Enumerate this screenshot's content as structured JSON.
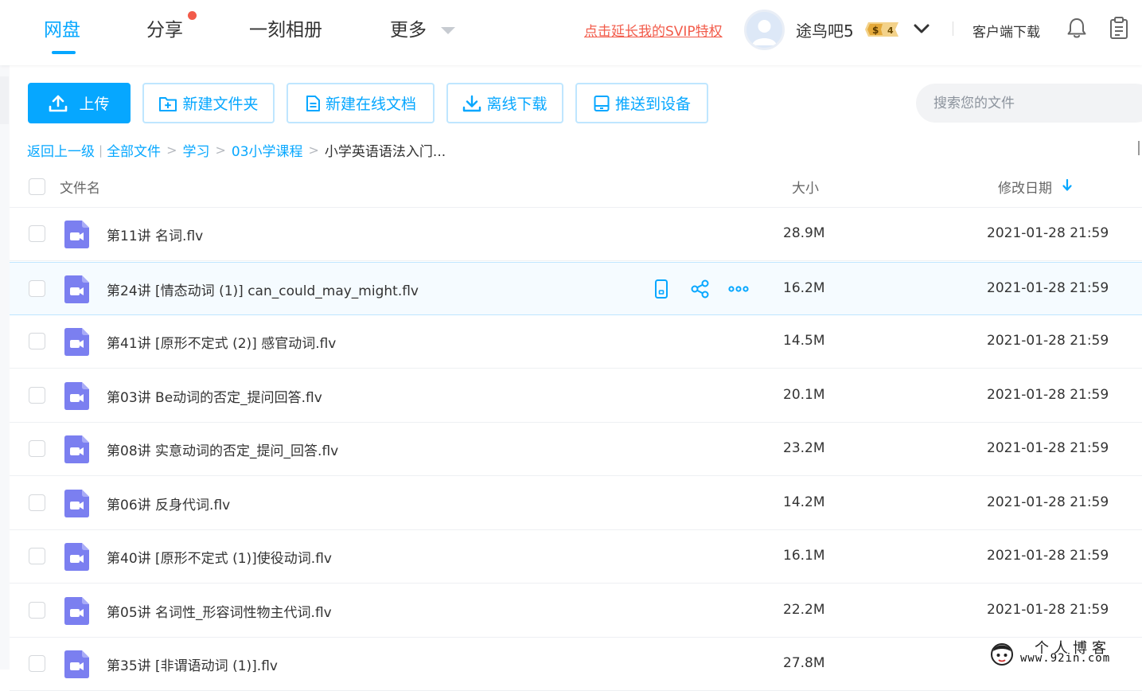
{
  "nav": {
    "items": [
      {
        "label": "网盘",
        "active": true
      },
      {
        "label": "分享",
        "has_dot": true
      },
      {
        "label": "一刻相册"
      },
      {
        "label": "更多",
        "has_dropdown": true
      }
    ],
    "svip_link": "点击延长我的SVIP特权",
    "username": "途鸟吧5",
    "vip_badge": "4",
    "client_download": "客户端下载"
  },
  "toolbar": {
    "upload": "上传",
    "new_folder": "新建文件夹",
    "new_online_doc": "新建在线文档",
    "offline_download": "离线下载",
    "push_to_device": "推送到设备",
    "search_placeholder": "搜索您的文件"
  },
  "breadcrumb": {
    "back": "返回上一级",
    "all_files": "全部文件",
    "items": [
      "学习",
      "03小学课程"
    ],
    "current": "小学英语语法入门..."
  },
  "table": {
    "headers": {
      "name": "文件名",
      "size": "大小",
      "date": "修改日期"
    },
    "rows": [
      {
        "name": "第11讲 名词.flv",
        "size": "28.9M",
        "date": "2021-01-28 21:59"
      },
      {
        "name": "第24讲 [情态动词 (1)] can_could_may_might.flv",
        "size": "16.2M",
        "date": "2021-01-28 21:59",
        "hover": true
      },
      {
        "name": "第41讲 [原形不定式 (2)] 感官动词.flv",
        "size": "14.5M",
        "date": "2021-01-28 21:59"
      },
      {
        "name": "第03讲 Be动词的否定_提问回答.flv",
        "size": "20.1M",
        "date": "2021-01-28 21:59"
      },
      {
        "name": "第08讲 实意动词的否定_提问_回答.flv",
        "size": "23.2M",
        "date": "2021-01-28 21:59"
      },
      {
        "name": "第06讲 反身代词.flv",
        "size": "14.2M",
        "date": "2021-01-28 21:59"
      },
      {
        "name": "第40讲 [原形不定式 (1)]使役动词.flv",
        "size": "16.1M",
        "date": "2021-01-28 21:59"
      },
      {
        "name": "第05讲 名词性_形容词性物主代词.flv",
        "size": "22.2M",
        "date": "2021-01-28 21:59"
      },
      {
        "name": "第35讲 [非谓语动词 (1)].flv",
        "size": "27.8M",
        "date": ""
      }
    ]
  },
  "watermark": {
    "title": "个人博客",
    "url": "www.92in.com"
  },
  "colors": {
    "accent": "#06a7ff",
    "svip_red": "#f25b4a",
    "video_icon": "#7b7ff0",
    "hover_row": "#f5fbff"
  }
}
